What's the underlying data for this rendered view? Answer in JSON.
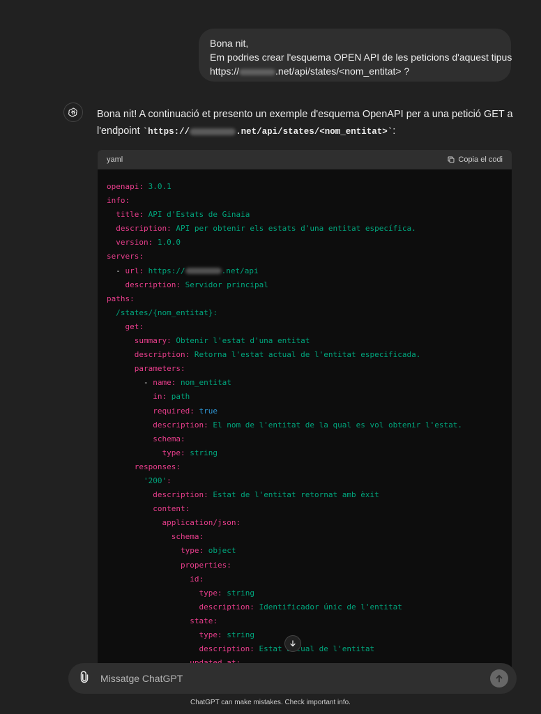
{
  "user_message": {
    "line1": "Bona nit,",
    "line2": "Em podries crear l'esquema OPEN API de les peticions d'aquest tipus",
    "line3_prefix": "https://",
    "line3_suffix": ".net/api/states/<nom_entitat> ?"
  },
  "assistant_message": {
    "text_part1": "Bona nit! A continuació et presento un exemple d'esquema OpenAPI per a una petició GET a l'endpoint ",
    "code_prefix": "`https://",
    "code_suffix": ".net/api/states/<nom_entitat>`",
    "text_end": ":"
  },
  "code_block": {
    "language": "yaml",
    "copy_label": "Copia el codi",
    "lines": [
      [
        {
          "c": "k",
          "t": "openapi:"
        },
        {
          "c": "s",
          "t": " 3.0.1"
        }
      ],
      [
        {
          "c": "k",
          "t": "info:"
        }
      ],
      [
        {
          "c": "t",
          "t": "  "
        },
        {
          "c": "k",
          "t": "title:"
        },
        {
          "c": "s",
          "t": " API d'Estats de Ginaia"
        }
      ],
      [
        {
          "c": "t",
          "t": "  "
        },
        {
          "c": "k",
          "t": "description:"
        },
        {
          "c": "s",
          "t": " API per obtenir els estats d'una entitat específica."
        }
      ],
      [
        {
          "c": "t",
          "t": "  "
        },
        {
          "c": "k",
          "t": "version:"
        },
        {
          "c": "s",
          "t": " 1.0.0"
        }
      ],
      [
        {
          "c": "k",
          "t": "servers:"
        }
      ],
      [
        {
          "c": "t",
          "t": "  - "
        },
        {
          "c": "k",
          "t": "url:"
        },
        {
          "c": "s",
          "t": " https://"
        },
        {
          "c": "blur",
          "t": ""
        },
        {
          "c": "s",
          "t": ".net/api"
        }
      ],
      [
        {
          "c": "t",
          "t": "    "
        },
        {
          "c": "k",
          "t": "description:"
        },
        {
          "c": "s",
          "t": " Servidor principal"
        }
      ],
      [
        {
          "c": "k",
          "t": "paths:"
        }
      ],
      [
        {
          "c": "t",
          "t": "  "
        },
        {
          "c": "s",
          "t": "/states/{nom_entitat}:"
        }
      ],
      [
        {
          "c": "t",
          "t": "    "
        },
        {
          "c": "k",
          "t": "get:"
        }
      ],
      [
        {
          "c": "t",
          "t": "      "
        },
        {
          "c": "k",
          "t": "summary:"
        },
        {
          "c": "s",
          "t": " Obtenir l'estat d'una entitat"
        }
      ],
      [
        {
          "c": "t",
          "t": "      "
        },
        {
          "c": "k",
          "t": "description:"
        },
        {
          "c": "s",
          "t": " Retorna l'estat actual de l'entitat especificada."
        }
      ],
      [
        {
          "c": "t",
          "t": "      "
        },
        {
          "c": "k",
          "t": "parameters:"
        }
      ],
      [
        {
          "c": "t",
          "t": "        - "
        },
        {
          "c": "k",
          "t": "name:"
        },
        {
          "c": "s",
          "t": " nom_entitat"
        }
      ],
      [
        {
          "c": "t",
          "t": "          "
        },
        {
          "c": "k",
          "t": "in:"
        },
        {
          "c": "s",
          "t": " path"
        }
      ],
      [
        {
          "c": "t",
          "t": "          "
        },
        {
          "c": "k",
          "t": "required:"
        },
        {
          "c": "b",
          "t": " true"
        }
      ],
      [
        {
          "c": "t",
          "t": "          "
        },
        {
          "c": "k",
          "t": "description:"
        },
        {
          "c": "s",
          "t": " El nom de l'entitat de la qual es vol obtenir l'estat."
        }
      ],
      [
        {
          "c": "t",
          "t": "          "
        },
        {
          "c": "k",
          "t": "schema:"
        }
      ],
      [
        {
          "c": "t",
          "t": "            "
        },
        {
          "c": "k",
          "t": "type:"
        },
        {
          "c": "s",
          "t": " string"
        }
      ],
      [
        {
          "c": "t",
          "t": "      "
        },
        {
          "c": "k",
          "t": "responses:"
        }
      ],
      [
        {
          "c": "t",
          "t": "        "
        },
        {
          "c": "s",
          "t": "'200'"
        },
        {
          "c": "k",
          "t": ":"
        }
      ],
      [
        {
          "c": "t",
          "t": "          "
        },
        {
          "c": "k",
          "t": "description:"
        },
        {
          "c": "s",
          "t": " Estat de l'entitat retornat amb èxit"
        }
      ],
      [
        {
          "c": "t",
          "t": "          "
        },
        {
          "c": "k",
          "t": "content:"
        }
      ],
      [
        {
          "c": "t",
          "t": "            "
        },
        {
          "c": "k",
          "t": "application/json:"
        }
      ],
      [
        {
          "c": "t",
          "t": "              "
        },
        {
          "c": "k",
          "t": "schema:"
        }
      ],
      [
        {
          "c": "t",
          "t": "                "
        },
        {
          "c": "k",
          "t": "type:"
        },
        {
          "c": "s",
          "t": " object"
        }
      ],
      [
        {
          "c": "t",
          "t": "                "
        },
        {
          "c": "k",
          "t": "properties:"
        }
      ],
      [
        {
          "c": "t",
          "t": "                  "
        },
        {
          "c": "k",
          "t": "id:"
        }
      ],
      [
        {
          "c": "t",
          "t": "                    "
        },
        {
          "c": "k",
          "t": "type:"
        },
        {
          "c": "s",
          "t": " string"
        }
      ],
      [
        {
          "c": "t",
          "t": "                    "
        },
        {
          "c": "k",
          "t": "description:"
        },
        {
          "c": "s",
          "t": " Identificador únic de l'entitat"
        }
      ],
      [
        {
          "c": "t",
          "t": "                  "
        },
        {
          "c": "k",
          "t": "state:"
        }
      ],
      [
        {
          "c": "t",
          "t": "                    "
        },
        {
          "c": "k",
          "t": "type:"
        },
        {
          "c": "s",
          "t": " string"
        }
      ],
      [
        {
          "c": "t",
          "t": "                    "
        },
        {
          "c": "k",
          "t": "description:"
        },
        {
          "c": "s",
          "t": " Estat actual de l'entitat"
        }
      ],
      [
        {
          "c": "t",
          "t": "                  "
        },
        {
          "c": "k",
          "t": "updated_at:"
        }
      ]
    ]
  },
  "composer": {
    "placeholder": "Missatge ChatGPT"
  },
  "footer": {
    "disclaimer": "ChatGPT can make mistakes. Check important info."
  },
  "colors": {
    "background": "#212121",
    "key": "#e83e8c",
    "string": "#00a67d",
    "boolean": "#2e95d3"
  },
  "icons": {
    "avatar": "openai-logo-icon",
    "copy": "copy-icon",
    "attach": "paperclip-icon",
    "send": "arrow-up-icon",
    "scroll": "arrow-down-icon"
  }
}
